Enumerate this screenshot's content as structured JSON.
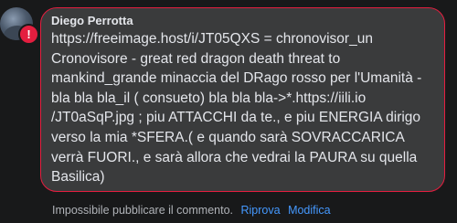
{
  "comment": {
    "author": "Diego Perrotta",
    "text": "https://freeimage.host/i/JT05QXS = chronovisor_un Cronovisore - great red dragon death threat to mankind_grande minaccia del DRago rosso per l'Umanità - bla bla bla_il ( consueto) bla bla bla->*.https://iili.io /JT0aSqP.jpg ; piu ATTACCHI da te., e piu ENERGIA dirigo verso la mia *SFERA.( e quando sarà SOVRACCARICA verrà FUORI., e sarà allora che vedrai la PAURA su quella Basilica)",
    "error_icon": "exclamation",
    "error_color": "#e41e3f"
  },
  "footer": {
    "status": "Impossibile pubblicare il commento.",
    "retry_label": "Riprova",
    "edit_label": "Modifica",
    "link_color": "#4599ff"
  }
}
